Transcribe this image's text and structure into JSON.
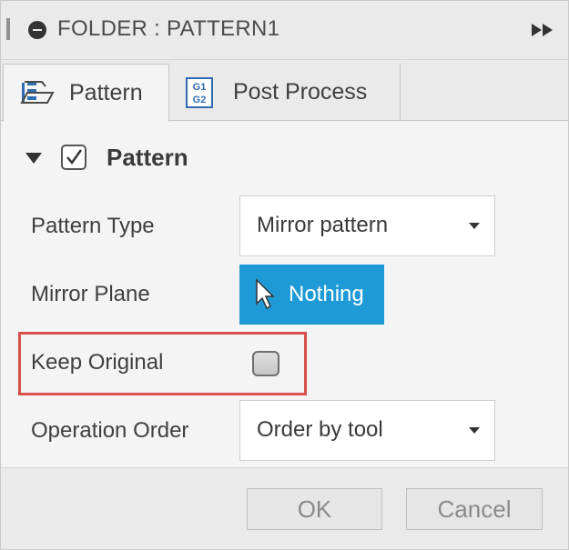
{
  "titlebar": {
    "title": "FOLDER : PATTERN1",
    "expand_icon": "fast-forward-icon"
  },
  "tabs": [
    {
      "label": "Pattern",
      "icon": "pattern-icon",
      "active": true
    },
    {
      "label": "Post Process",
      "icon": "g1-g2-icon",
      "active": false
    }
  ],
  "section": {
    "title": "Pattern",
    "enabled": true,
    "expanded": true
  },
  "fields": {
    "pattern_type": {
      "label": "Pattern Type",
      "value": "Mirror pattern"
    },
    "mirror_plane": {
      "label": "Mirror Plane",
      "value": "Nothing"
    },
    "keep_original": {
      "label": "Keep Original",
      "checked": false
    },
    "operation_order": {
      "label": "Operation Order",
      "value": "Order by tool"
    }
  },
  "buttons": {
    "ok": "OK",
    "cancel": "Cancel"
  },
  "colors": {
    "selection_button": "#1e9bd7",
    "highlight_box": "#d9514a"
  }
}
